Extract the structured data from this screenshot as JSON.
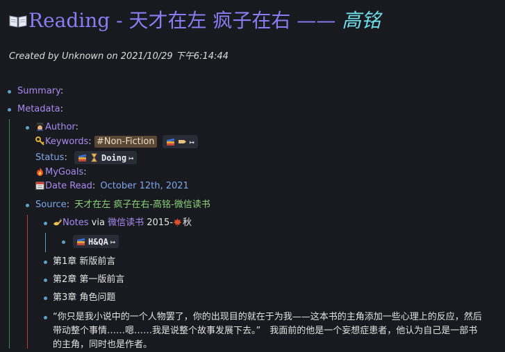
{
  "header": {
    "title_icon": "open-book-icon",
    "title_main": "Reading - 天才在左 疯子在右 —— ",
    "title_author": "高铭",
    "created": "Created by Unknown on 2021/10/29 下午6:14:44"
  },
  "summary": {
    "label": "Summary",
    "colon": ":"
  },
  "metadata": {
    "label": "Metadata",
    "colon": ":",
    "author_icon": "detective-icon",
    "author_label": "Author",
    "author_colon": ":",
    "keywords_icon": "key-icon",
    "keywords_label": "Keywords",
    "keywords_colon": ":",
    "keywords_tag": "#Non-Fiction",
    "status_label": "Status",
    "status_colon": ":",
    "status_value": "Doing",
    "goals_icon": "fire-icon",
    "goals_label": "MyGoals",
    "goals_colon": ":",
    "date_icon": "calendar-icon",
    "date_label": "Date Read",
    "date_colon": ":",
    "date_value": "October 12th, 2021"
  },
  "source": {
    "label": "Source",
    "colon": ":",
    "value": "天才在左 疯子在右-高铭-微信读书",
    "notes_icon": "writing-hand-icon",
    "notes_label": "Notes",
    "notes_via": " via ",
    "notes_app": "微信读书",
    "notes_year": " 2015-",
    "notes_season": "秋",
    "hqa_label": "H&QA"
  },
  "chapters": [
    "第1章 新版前言",
    "第2章 第一版前言",
    "第3章 角色问题"
  ],
  "quote": "“你只是我小说中的一个人物罢了，你的出现目的就在于为我——这本书的主角添加一些心理上的反应，然后带动整个事情……嗯……我是说整个故事发展下去。”　我面前的他是一个妄想症患者，他认为自己是一部书的主角，同时也是作者。",
  "colors": {
    "bg": "#191a20",
    "accent_purple": "#8a7cf2",
    "link": "#a58cf0",
    "green": "#8bd37a",
    "bullet": "#5ea2c6",
    "tag_bg": "#5a4736"
  }
}
